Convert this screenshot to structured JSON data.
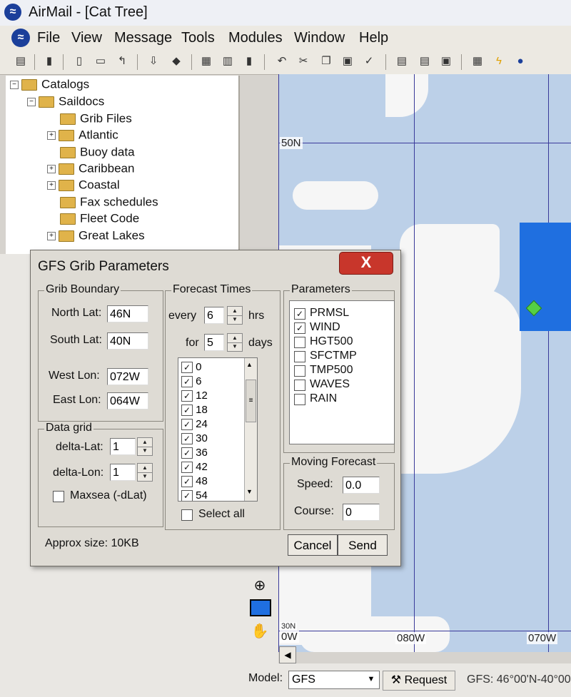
{
  "window": {
    "title": "AirMail - [Cat Tree]"
  },
  "menu": {
    "items": [
      "File",
      "View",
      "Message",
      "Tools",
      "Modules",
      "Window",
      "Help"
    ]
  },
  "toolbar": {
    "icons": [
      "list-icon",
      "phone-icon",
      "new-message-icon",
      "open-folder-icon",
      "reply-icon",
      "download-icon",
      "attach-icon",
      "print-icon",
      "outbox-icon",
      "trash-icon",
      "undo-icon",
      "cut-icon",
      "copy-icon",
      "paste-icon",
      "spellcheck-icon",
      "address-book-icon",
      "view-icon",
      "panel-icon",
      "map-icon",
      "lightning-icon",
      "globe-icon"
    ]
  },
  "tree": {
    "root": "Catalogs",
    "child": "Saildocs",
    "items": [
      {
        "label": "Grib Files",
        "expandable": false
      },
      {
        "label": "Atlantic",
        "expandable": true
      },
      {
        "label": "Buoy data",
        "expandable": false
      },
      {
        "label": "Caribbean",
        "expandable": true
      },
      {
        "label": "Coastal",
        "expandable": true
      },
      {
        "label": "Fax schedules",
        "expandable": false
      },
      {
        "label": "Fleet Code",
        "expandable": false
      },
      {
        "label": "Great Lakes",
        "expandable": true
      }
    ]
  },
  "map": {
    "lat_labels": [
      "50N"
    ],
    "bottom_labels": [
      "30N",
      "0W",
      "080W",
      "070W"
    ]
  },
  "statusbar": {
    "model_label": "Model:",
    "model_value": "GFS",
    "request_label": "Request",
    "region_text": "GFS: 46°00'N-40°00"
  },
  "dialog": {
    "title": "GFS Grib Parameters",
    "close_label": "X",
    "grib_boundary": {
      "legend": "Grib Boundary",
      "north_label": "North Lat:",
      "north_value": "46N",
      "south_label": "South Lat:",
      "south_value": "40N",
      "west_label": "West Lon:",
      "west_value": "072W",
      "east_label": "East Lon:",
      "east_value": "064W"
    },
    "data_grid": {
      "legend": "Data grid",
      "dlat_label": "delta-Lat:",
      "dlat_value": "1",
      "dlon_label": "delta-Lon:",
      "dlon_value": "1",
      "maxsea_label": "Maxsea (-dLat)",
      "maxsea_checked": false
    },
    "forecast_times": {
      "legend": "Forecast Times",
      "every_label": "every",
      "every_value": "6",
      "hrs_label": "hrs",
      "for_label": "for",
      "for_value": "5",
      "days_label": "days",
      "hours": [
        "0",
        "6",
        "12",
        "18",
        "24",
        "30",
        "36",
        "42",
        "48",
        "54"
      ],
      "select_all_label": "Select all"
    },
    "parameters": {
      "legend": "Parameters",
      "items": [
        {
          "label": "PRMSL",
          "checked": true
        },
        {
          "label": "WIND",
          "checked": true
        },
        {
          "label": "HGT500",
          "checked": false
        },
        {
          "label": "SFCTMP",
          "checked": false
        },
        {
          "label": "TMP500",
          "checked": false
        },
        {
          "label": "WAVES",
          "checked": false
        },
        {
          "label": "RAIN",
          "checked": false
        }
      ]
    },
    "moving_forecast": {
      "legend": "Moving Forecast",
      "speed_label": "Speed:",
      "speed_value": "0.0",
      "course_label": "Course:",
      "course_value": "0"
    },
    "approx_size": "Approx size: 10KB",
    "cancel_label": "Cancel",
    "send_label": "Send"
  },
  "colors": {
    "forecast_area": "#1f6fe0",
    "marker": "#55d044",
    "close_button": "#c8362b",
    "sea": "#bcd0e8"
  }
}
